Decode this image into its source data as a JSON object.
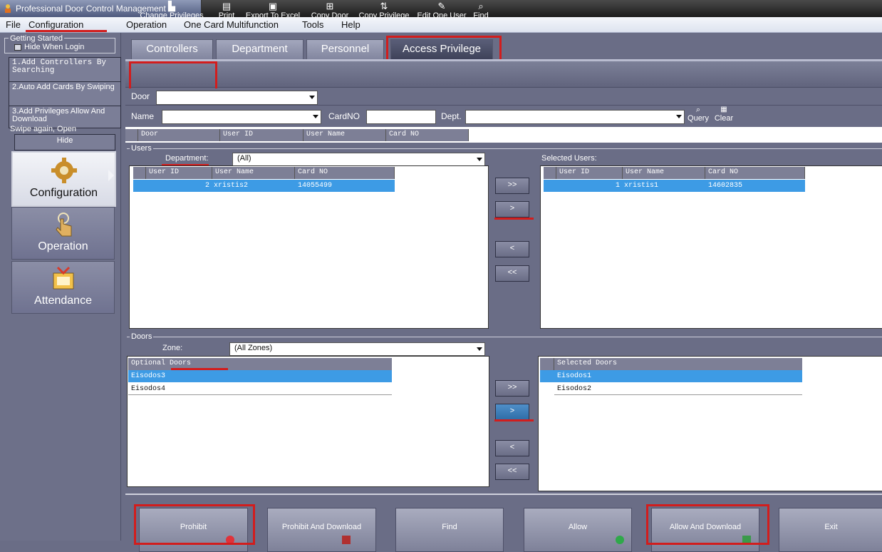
{
  "window": {
    "title": "Professional Door Control Management"
  },
  "menu": [
    "File",
    "Configuration",
    "Operation",
    "One Card Multifunction",
    "Tools",
    "Help"
  ],
  "sidebar": {
    "getting_started": {
      "title": "Getting Started",
      "hide_when_login": "Hide When Login"
    },
    "steps": [
      "1.Add Controllers By Searching",
      "2.Auto Add Cards By Swiping",
      "3.Add Privileges Allow And Download",
      "Swipe again, Open"
    ],
    "hide_label": "Hide",
    "nav": [
      "Configuration",
      "Operation",
      "Attendance"
    ]
  },
  "tabs": [
    "Controllers",
    "Department",
    "Personnel",
    "Access Privilege"
  ],
  "toolbar": [
    "Change Privileges",
    "Print",
    "Export To Excel",
    "Copy Door",
    "Copy Privilege",
    "Edit One User",
    "Find"
  ],
  "filters": {
    "door_label": "Door",
    "name_label": "Name",
    "cardno_label": "CardNO",
    "dept_label": "Dept.",
    "query_label": "Query",
    "clear_label": "Clear"
  },
  "result_headers": [
    "Door",
    "User ID",
    "User Name",
    "Card NO"
  ],
  "users": {
    "group_label": "Users",
    "department_label": "Department:",
    "department_value": "(All)",
    "selected_label": "Selected Users:",
    "headers": [
      "User ID",
      "User Name",
      "Card NO"
    ],
    "available": [
      {
        "id": "2",
        "name": "xristis2",
        "card": "14055499"
      }
    ],
    "selected": [
      {
        "id": "1",
        "name": "xristis1",
        "card": "14602835"
      }
    ]
  },
  "doors": {
    "group_label": "Doors",
    "zone_label": "Zone:",
    "zone_value": "(All Zones)",
    "optional_header": "Optional Doors",
    "selected_header": "Selected Doors",
    "optional": [
      "Eisodos3",
      "Eisodos4"
    ],
    "selected": [
      "Eisodos1",
      "Eisodos2"
    ]
  },
  "move_buttons": [
    ">>",
    ">",
    "<",
    "<<"
  ],
  "bottom_buttons": [
    "Prohibit",
    "Prohibit And Download",
    "Find",
    "Allow",
    "Allow And Download",
    "Exit"
  ],
  "colors": {
    "highlight_red": "#d21d1d",
    "selection_blue": "#3d9be5"
  }
}
